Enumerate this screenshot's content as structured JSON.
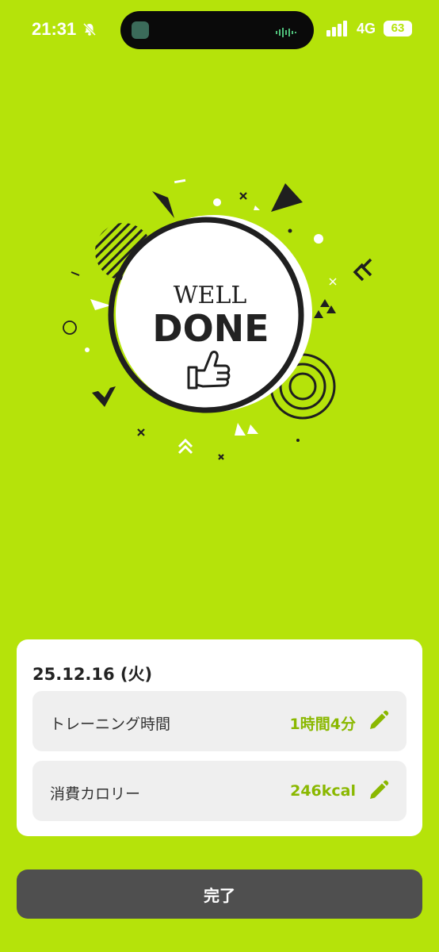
{
  "status_bar": {
    "time": "21:31",
    "network": "4G",
    "battery": "63"
  },
  "badge": {
    "line1": "WELL",
    "line2": "DONE",
    "icon": "thumbs-up-icon"
  },
  "summary": {
    "date": "25.12.16 (火)",
    "rows": [
      {
        "label": "トレーニング時間",
        "value": "1時間4分",
        "icon": "pencil-icon"
      },
      {
        "label": "消費カロリー",
        "value": "246kcal",
        "icon": "pencil-icon"
      }
    ]
  },
  "actions": {
    "done_label": "完了"
  },
  "colors": {
    "background": "#b5e30a",
    "accent": "#8ab800",
    "button": "#4f4f4f"
  }
}
